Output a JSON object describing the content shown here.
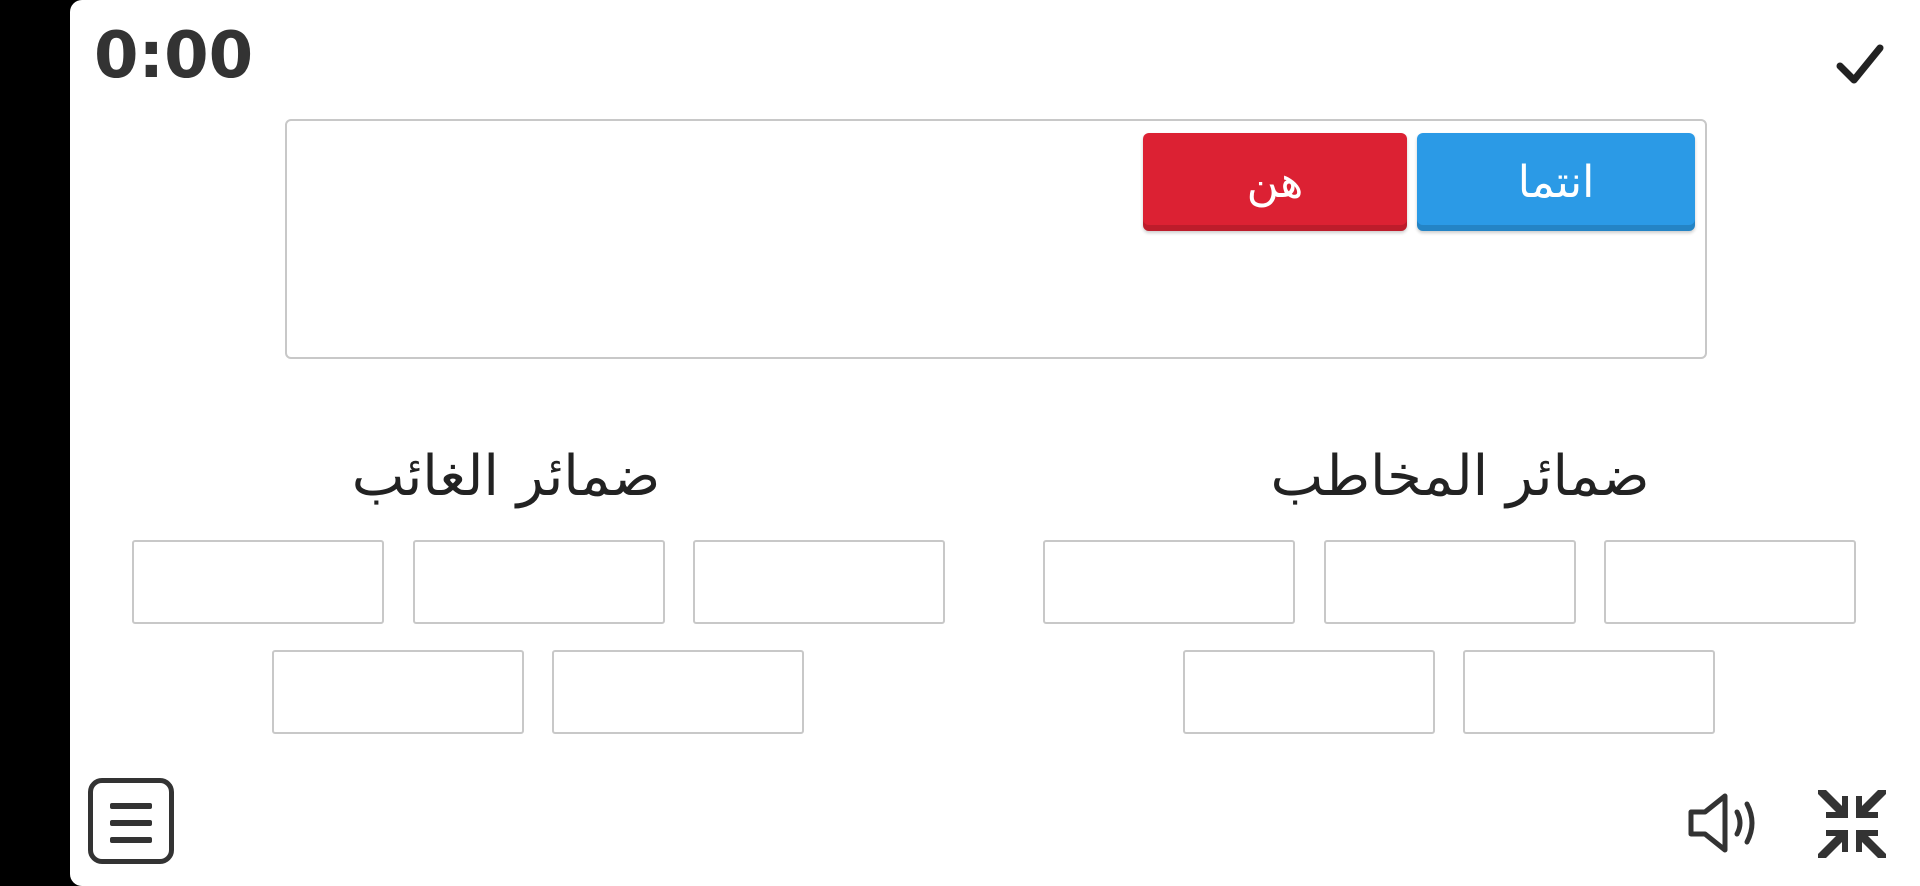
{
  "timer": {
    "value": "0:00"
  },
  "tray": {
    "tiles": [
      {
        "label": "انتما",
        "color": "#2b9ae6"
      },
      {
        "label": "هن",
        "color": "#dc2133"
      }
    ]
  },
  "groups": [
    {
      "title": "ضمائر المخاطب",
      "slot_count": 5
    },
    {
      "title": "ضمائر الغائب",
      "slot_count": 5
    }
  ],
  "icons": {
    "check": "check-icon",
    "menu": "menu-icon",
    "sound": "speaker-icon",
    "collapse": "collapse-icon"
  }
}
